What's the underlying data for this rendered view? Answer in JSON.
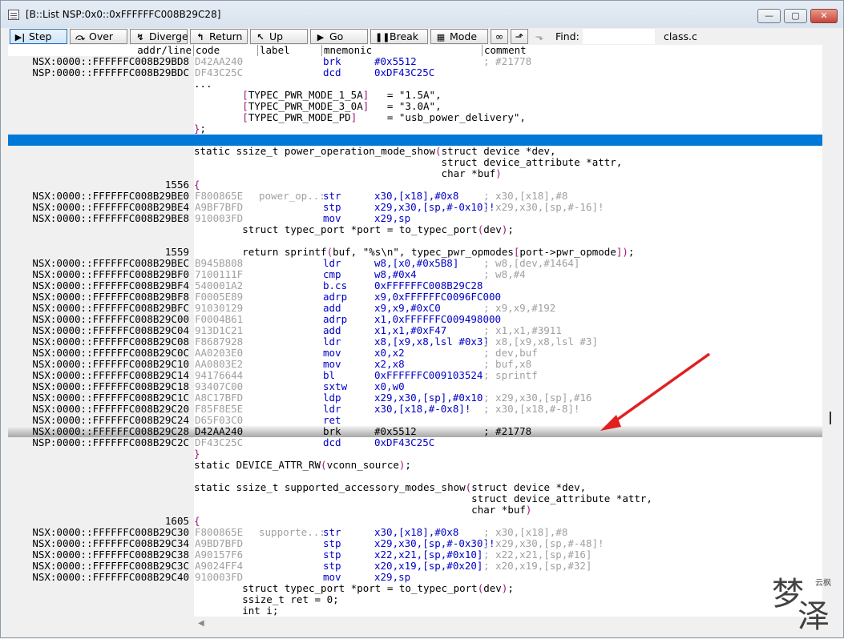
{
  "window": {
    "title": "[B::List NSP:0x0::0xFFFFFFC008B29C28]",
    "buttons": {
      "minimize": "—",
      "restore": "▢",
      "close": "✕"
    }
  },
  "toolbar": {
    "step": "Step",
    "over": "Over",
    "diverge": "Diverge",
    "return": "Return",
    "up": "Up",
    "go": "Go",
    "break": "Break",
    "mode": "Mode",
    "find_label": "Find:",
    "find_value": "",
    "file": "class.c"
  },
  "columns": {
    "addr": "addr/line",
    "code": "code",
    "label": "label",
    "mnemonic": "mnemonic",
    "comment": "comment"
  },
  "rows": [
    {
      "addr": "NSX:0000::FFFFFFC008B29BD8",
      "code": "D42AA240",
      "label": "",
      "mnem": "brk",
      "ops": "#0x5512",
      "comment": "; #21778"
    },
    {
      "addr": "NSP:0000::FFFFFFC008B29BDC",
      "code": "DF43C25C",
      "label": "",
      "mnem": "dcd",
      "ops": "0xDF43C25C",
      "comment": ""
    },
    {
      "src": "..."
    },
    {
      "src": "        [TYPEC_PWR_MODE_1_5A]   = \"1.5A\","
    },
    {
      "src": "        [TYPEC_PWR_MODE_3_0A]   = \"3.0A\","
    },
    {
      "src": "        [TYPEC_PWR_MODE_PD]     = \"usb_power_delivery\","
    },
    {
      "src": "};"
    },
    {
      "src": "",
      "selected": true
    },
    {
      "src": "static ssize_t power_operation_mode_show(struct device *dev,"
    },
    {
      "src": "                                         struct device_attribute *attr,"
    },
    {
      "src": "                                         char *buf)"
    },
    {
      "line": "1556",
      "src": "{"
    },
    {
      "addr": "NSX:0000::FFFFFFC008B29BE0",
      "code": "F800865E",
      "label": "power_op..:",
      "mnem": "str",
      "ops": "x30,[x18],#0x8",
      "comment": "; x30,[x18],#8"
    },
    {
      "addr": "NSX:0000::FFFFFFC008B29BE4",
      "code": "A9BF7BFD",
      "label": "",
      "mnem": "stp",
      "ops": "x29,x30,[sp,#-0x10]!",
      "comment": "; x29,x30,[sp,#-16]!"
    },
    {
      "addr": "NSX:0000::FFFFFFC008B29BE8",
      "code": "910003FD",
      "label": "",
      "mnem": "mov",
      "ops": "x29,sp",
      "comment": ""
    },
    {
      "src": "        struct typec_port *port = to_typec_port(dev);"
    },
    {
      "src": ""
    },
    {
      "line": "1559",
      "src": "        return sprintf(buf, \"%s\\n\", typec_pwr_opmodes[port->pwr_opmode]);"
    },
    {
      "addr": "NSX:0000::FFFFFFC008B29BEC",
      "code": "B945B808",
      "label": "",
      "mnem": "ldr",
      "ops": "w8,[x0,#0x5B8]",
      "comment": "; w8,[dev,#1464]"
    },
    {
      "addr": "NSX:0000::FFFFFFC008B29BF0",
      "code": "7100111F",
      "label": "",
      "mnem": "cmp",
      "ops": "w8,#0x4",
      "comment": "; w8,#4"
    },
    {
      "addr": "NSX:0000::FFFFFFC008B29BF4",
      "code": "540001A2",
      "label": "",
      "mnem": "b.cs",
      "ops": "0xFFFFFFC008B29C28",
      "comment": ""
    },
    {
      "addr": "NSX:0000::FFFFFFC008B29BF8",
      "code": "F0005E89",
      "label": "",
      "mnem": "adrp",
      "ops": "x9,0xFFFFFFC0096FC000",
      "comment": ""
    },
    {
      "addr": "NSX:0000::FFFFFFC008B29BFC",
      "code": "91030129",
      "label": "",
      "mnem": "add",
      "ops": "x9,x9,#0xC0",
      "comment": "; x9,x9,#192"
    },
    {
      "addr": "NSX:0000::FFFFFFC008B29C00",
      "code": "F0004B61",
      "label": "",
      "mnem": "adrp",
      "ops": "x1,0xFFFFFFC009498000",
      "comment": ""
    },
    {
      "addr": "NSX:0000::FFFFFFC008B29C04",
      "code": "913D1C21",
      "label": "",
      "mnem": "add",
      "ops": "x1,x1,#0xF47",
      "comment": "; x1,x1,#3911"
    },
    {
      "addr": "NSX:0000::FFFFFFC008B29C08",
      "code": "F8687928",
      "label": "",
      "mnem": "ldr",
      "ops": "x8,[x9,x8,lsl #0x3]",
      "comment": "; x8,[x9,x8,lsl #3]"
    },
    {
      "addr": "NSX:0000::FFFFFFC008B29C0C",
      "code": "AA0203E0",
      "label": "",
      "mnem": "mov",
      "ops": "x0,x2",
      "comment": "; dev,buf"
    },
    {
      "addr": "NSX:0000::FFFFFFC008B29C10",
      "code": "AA0803E2",
      "label": "",
      "mnem": "mov",
      "ops": "x2,x8",
      "comment": "; buf,x8"
    },
    {
      "addr": "NSX:0000::FFFFFFC008B29C14",
      "code": "94176644",
      "label": "",
      "mnem": "bl",
      "ops": "0xFFFFFFC009103524",
      "comment": "; sprintf"
    },
    {
      "addr": "NSX:0000::FFFFFFC008B29C18",
      "code": "93407C00",
      "label": "",
      "mnem": "sxtw",
      "ops": "x0,w0",
      "comment": ""
    },
    {
      "addr": "NSX:0000::FFFFFFC008B29C1C",
      "code": "A8C17BFD",
      "label": "",
      "mnem": "ldp",
      "ops": "x29,x30,[sp],#0x10",
      "comment": "; x29,x30,[sp],#16"
    },
    {
      "addr": "NSX:0000::FFFFFFC008B29C20",
      "code": "F85F8E5E",
      "label": "",
      "mnem": "ldr",
      "ops": "x30,[x18,#-0x8]!",
      "comment": "; x30,[x18,#-8]!"
    },
    {
      "addr": "NSX:0000::FFFFFFC008B29C24",
      "code": "D65F03C0",
      "label": "",
      "mnem": "ret",
      "ops": "",
      "comment": ""
    },
    {
      "addr": "NSX:0000::FFFFFFC008B29C28",
      "code": "D42AA240",
      "label": "",
      "mnem": "brk",
      "ops": "#0x5512",
      "comment": "; #21778",
      "current": true
    },
    {
      "addr": "NSP:0000::FFFFFFC008B29C2C",
      "code": "DF43C25C",
      "label": "",
      "mnem": "dcd",
      "ops": "0xDF43C25C",
      "comment": ""
    },
    {
      "src": "}"
    },
    {
      "src": "static DEVICE_ATTR_RW(vconn_source);"
    },
    {
      "src": ""
    },
    {
      "src": "static ssize_t supported_accessory_modes_show(struct device *dev,"
    },
    {
      "src": "                                              struct device_attribute *attr,"
    },
    {
      "src": "                                              char *buf)"
    },
    {
      "line": "1605",
      "src": "{"
    },
    {
      "addr": "NSX:0000::FFFFFFC008B29C30",
      "code": "F800865E",
      "label": "supporte..:",
      "mnem": "str",
      "ops": "x30,[x18],#0x8",
      "comment": "; x30,[x18],#8"
    },
    {
      "addr": "NSX:0000::FFFFFFC008B29C34",
      "code": "A9BD7BFD",
      "label": "",
      "mnem": "stp",
      "ops": "x29,x30,[sp,#-0x30]!",
      "comment": "; x29,x30,[sp,#-48]!"
    },
    {
      "addr": "NSX:0000::FFFFFFC008B29C38",
      "code": "A90157F6",
      "label": "",
      "mnem": "stp",
      "ops": "x22,x21,[sp,#0x10]",
      "comment": "; x22,x21,[sp,#16]"
    },
    {
      "addr": "NSX:0000::FFFFFFC008B29C3C",
      "code": "A9024FF4",
      "label": "",
      "mnem": "stp",
      "ops": "x20,x19,[sp,#0x20]",
      "comment": "; x20,x19,[sp,#32]"
    },
    {
      "addr": "NSX:0000::FFFFFFC008B29C40",
      "code": "910003FD",
      "label": "",
      "mnem": "mov",
      "ops": "x29,sp",
      "comment": ""
    },
    {
      "src": "        struct typec_port *port = to_typec_port(dev);"
    },
    {
      "src": "        ssize_t ret = 0;"
    },
    {
      "src": "        int i;"
    }
  ],
  "watermark": {
    "chars": "梦泽",
    "small": "云枫"
  },
  "colors": {
    "selection": "#0078d7",
    "source_bracket": "#a0147a",
    "arrow": "#e02020"
  }
}
